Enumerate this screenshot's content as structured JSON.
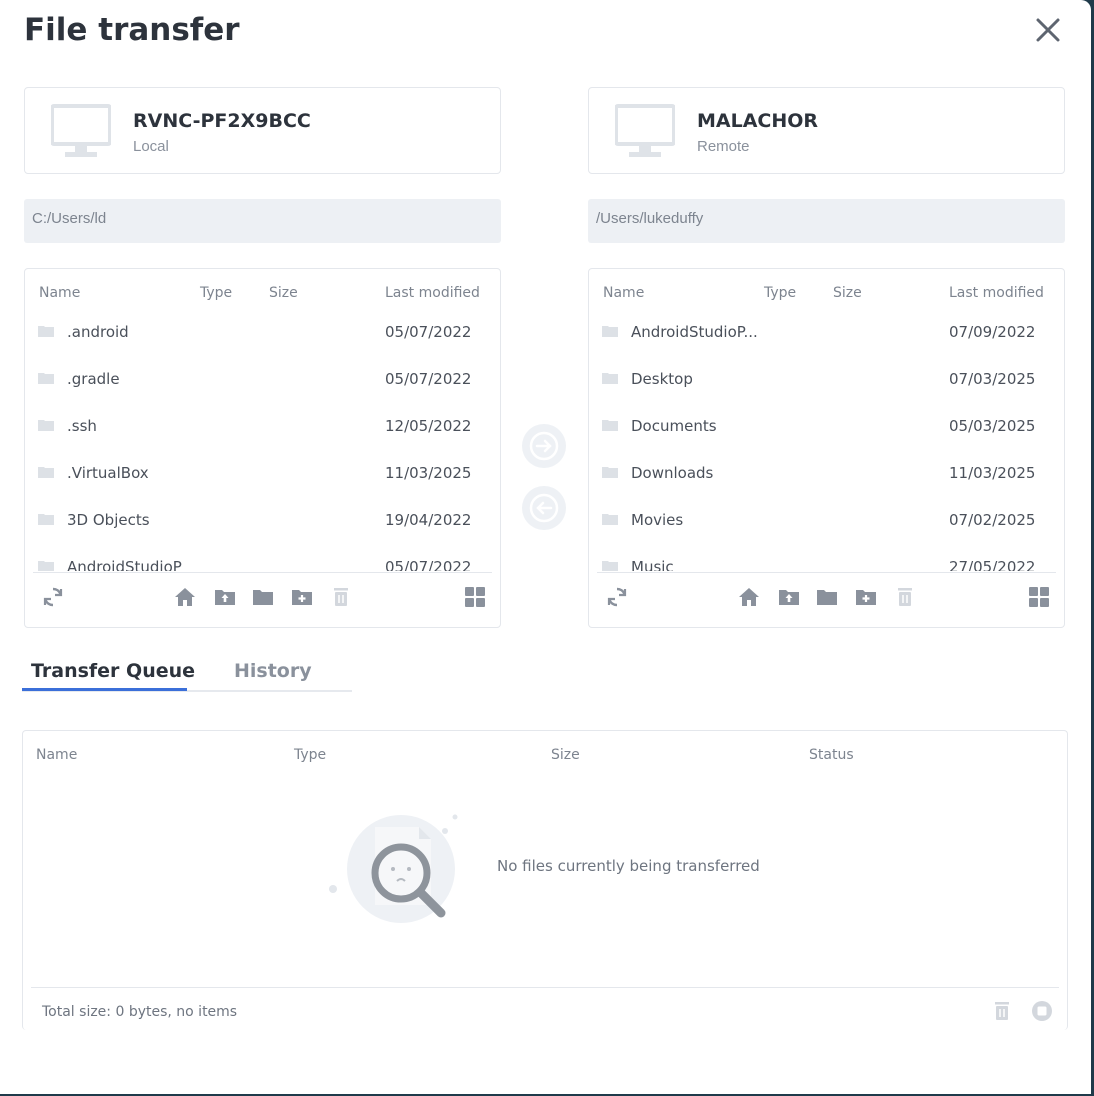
{
  "dialog": {
    "title": "File transfer"
  },
  "local": {
    "host_name": "RVNC-PF2X9BCC",
    "host_role": "Local",
    "path": "C:/Users/ld",
    "columns": {
      "name": "Name",
      "type": "Type",
      "size": "Size",
      "modified": "Last modified"
    },
    "files": [
      {
        "name": ".android",
        "modified": "05/07/2022"
      },
      {
        "name": ".gradle",
        "modified": "05/07/2022"
      },
      {
        "name": ".ssh",
        "modified": "12/05/2022"
      },
      {
        "name": ".VirtualBox",
        "modified": "11/03/2025"
      },
      {
        "name": "3D Objects",
        "modified": "19/04/2022"
      },
      {
        "name": "AndroidStudioP",
        "modified": "05/07/2022"
      }
    ]
  },
  "remote": {
    "host_name": "MALACHOR",
    "host_role": "Remote",
    "path": "/Users/lukeduffy",
    "columns": {
      "name": "Name",
      "type": "Type",
      "size": "Size",
      "modified": "Last modified"
    },
    "files": [
      {
        "name": "AndroidStudioP...",
        "modified": "07/09/2022"
      },
      {
        "name": "Desktop",
        "modified": "07/03/2025"
      },
      {
        "name": "Documents",
        "modified": "05/03/2025"
      },
      {
        "name": "Downloads",
        "modified": "11/03/2025"
      },
      {
        "name": "Movies",
        "modified": "07/02/2025"
      },
      {
        "name": "Music",
        "modified": "27/05/2022"
      }
    ]
  },
  "tabs": [
    {
      "label": "Transfer Queue",
      "active": true
    },
    {
      "label": "History",
      "active": false
    }
  ],
  "queue": {
    "columns": {
      "name": "Name",
      "type": "Type",
      "size": "Size",
      "status": "Status"
    },
    "empty_message": "No files currently being transferred",
    "total": "Total size: 0 bytes, no items"
  },
  "icons": {
    "close": "close-icon",
    "monitor": "monitor-icon",
    "folder": "folder-icon",
    "refresh": "refresh-icon",
    "home": "home-icon",
    "upload_folder": "folder-up-icon",
    "new_folder": "new-folder-icon",
    "delete": "trash-icon",
    "grid_view": "grid-view-icon",
    "send_right": "arrow-right-circle-icon",
    "send_left": "arrow-left-circle-icon",
    "stop": "stop-circle-icon"
  },
  "colors": {
    "accent": "#3b6fd9",
    "icon": "#8a919c",
    "icon_disabled": "#d3d7dd",
    "panel_bg": "#edf0f4"
  }
}
